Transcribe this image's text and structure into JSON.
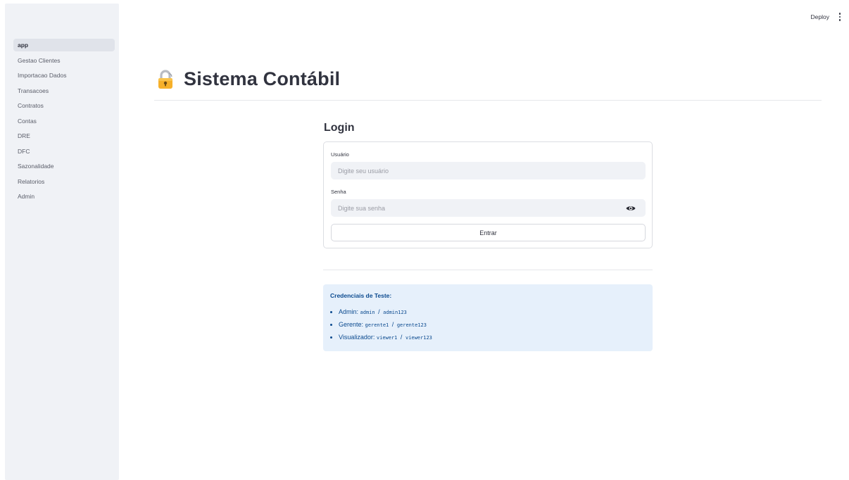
{
  "toolbar": {
    "deploy_label": "Deploy",
    "menu_icon": "kebab-menu-icon"
  },
  "sidebar": {
    "items": [
      {
        "label": "app",
        "active": true
      },
      {
        "label": "Gestao Clientes"
      },
      {
        "label": "Importacao Dados"
      },
      {
        "label": "Transacoes"
      },
      {
        "label": "Contratos"
      },
      {
        "label": "Contas"
      },
      {
        "label": "DRE"
      },
      {
        "label": "DFC"
      },
      {
        "label": "Sazonalidade"
      },
      {
        "label": "Relatorios"
      },
      {
        "label": "Admin"
      }
    ]
  },
  "header": {
    "icon": "lock-icon",
    "title": "Sistema Contábil"
  },
  "login": {
    "heading": "Login",
    "username_label": "Usuário",
    "username_placeholder": "Digite seu usuário",
    "password_label": "Senha",
    "password_placeholder": "Digite sua senha",
    "password_toggle_icon": "eye-icon",
    "submit_label": "Entrar"
  },
  "credentials": {
    "title": "Credenciais de Teste:",
    "items": [
      {
        "role": "Admin:",
        "user": "admin",
        "password": "admin123"
      },
      {
        "role": "Gerente:",
        "user": "gerente1",
        "password": "gerente123"
      },
      {
        "role": "Visualizador:",
        "user": "viewer1",
        "password": "viewer123"
      }
    ],
    "separator": "/"
  },
  "colors": {
    "sidebar_bg": "#f0f2f6",
    "info_bg": "#e6f0fb",
    "info_text": "#0b4a8f",
    "input_bg": "#f0f2f6"
  }
}
